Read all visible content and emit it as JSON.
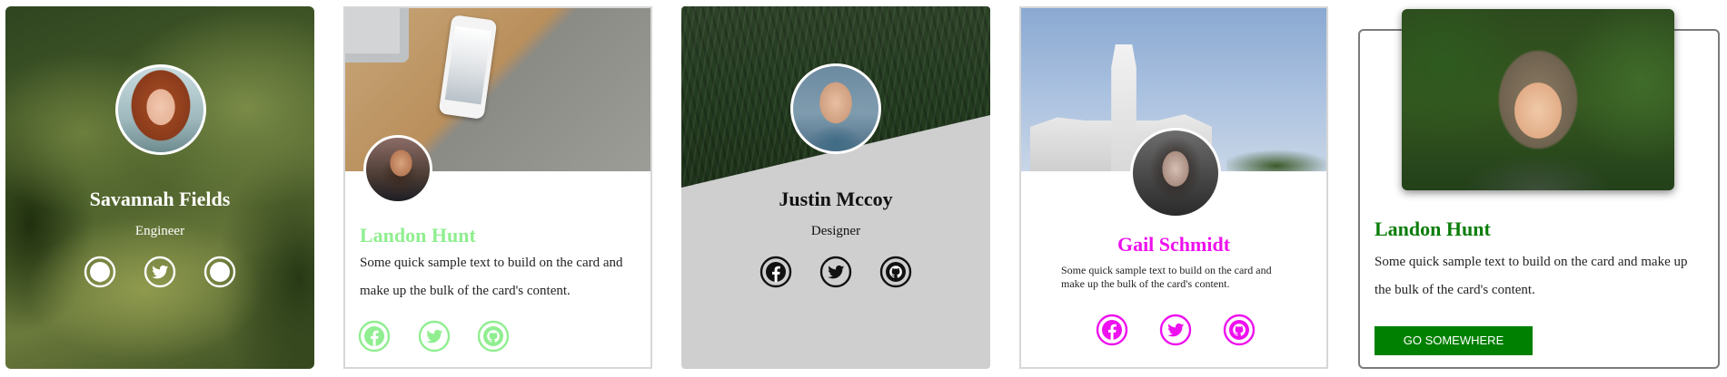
{
  "cards": [
    {
      "name": "Savannah Fields",
      "role": "Engineer",
      "icon_color": "#ffffff",
      "icons": [
        "facebook-icon",
        "twitter-icon",
        "github-icon"
      ]
    },
    {
      "name": "Landon Hunt",
      "name_color": "#90ee90",
      "text": "Some quick sample text to build on the card and make up the bulk of the card's content.",
      "icon_color": "#90ee90",
      "icons": [
        "facebook-icon",
        "twitter-icon",
        "github-icon"
      ]
    },
    {
      "name": "Justin Mccoy",
      "role": "Designer",
      "icon_color": "#111111",
      "icons": [
        "facebook-icon",
        "twitter-icon",
        "github-icon"
      ]
    },
    {
      "name": "Gail Schmidt",
      "name_color": "#ee10ee",
      "text": "Some quick sample text to build on the card and make up the bulk of the card's content.",
      "icon_color": "#ee10ee",
      "icons": [
        "facebook-icon",
        "twitter-icon",
        "github-icon"
      ]
    },
    {
      "name": "Landon Hunt",
      "name_color": "#0b7d0b",
      "text": "Some quick sample text to build on the card and make up the bulk of the card's content.",
      "button_label": "Go somewhere",
      "button_color": "#008000"
    }
  ]
}
